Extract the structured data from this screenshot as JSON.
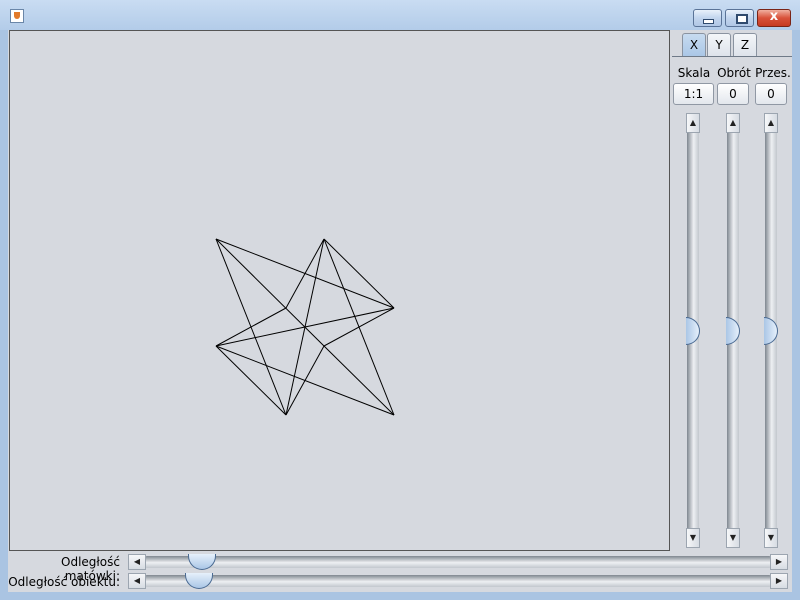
{
  "window": {
    "close_symbol": "x"
  },
  "tabs": [
    {
      "label": "X",
      "active": true
    },
    {
      "label": "Y",
      "active": false
    },
    {
      "label": "Z",
      "active": false
    }
  ],
  "controls": {
    "columns": [
      {
        "label": "Skala",
        "value": "1:1",
        "slider_level": 0.5
      },
      {
        "label": "Obrót",
        "value": "0",
        "slider_level": 0.5
      },
      {
        "label": "Przes.",
        "value": "0",
        "slider_level": 0.5
      }
    ]
  },
  "bottom": {
    "screen_distance_label": "Odległość matówki:",
    "screen_distance_level": 0.07,
    "object_distance_label": "Odległość obiektu:",
    "object_distance_level": 0.065
  },
  "colors": {
    "accent": "#aac6e6",
    "canvas_bg": "#d6d9df",
    "window_frame": "#aac4e2",
    "close": "#c63b22"
  }
}
